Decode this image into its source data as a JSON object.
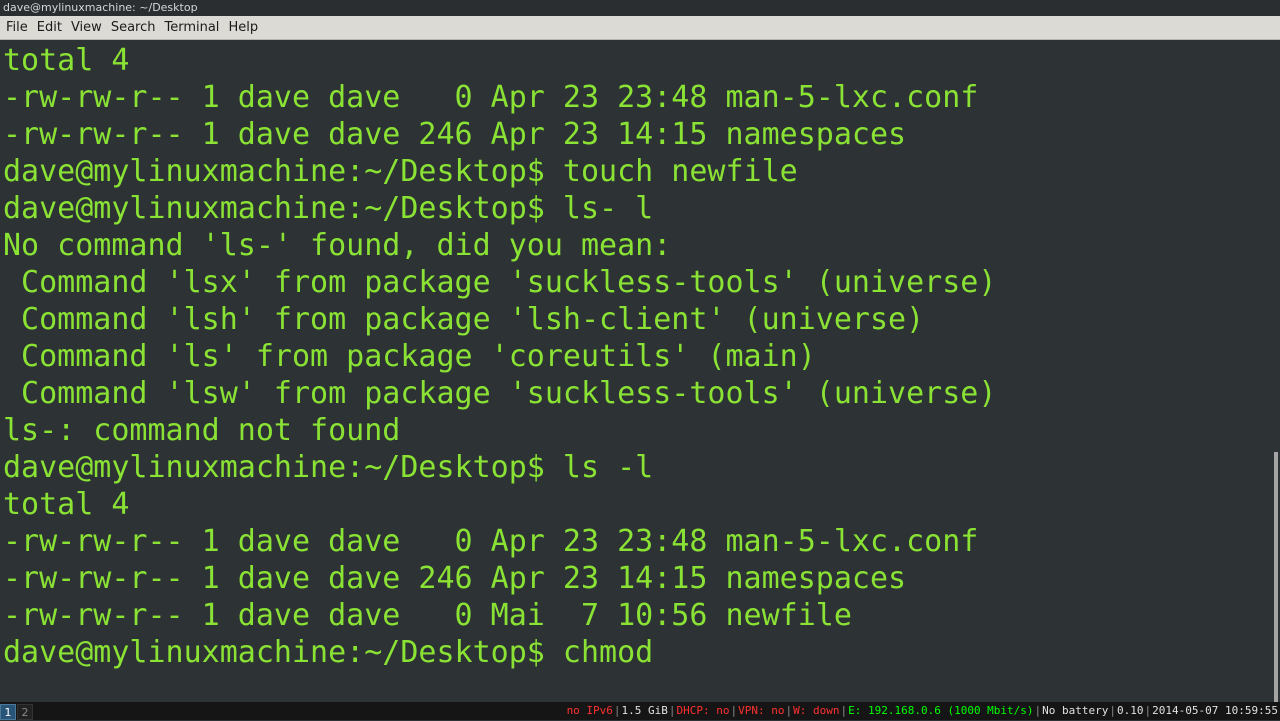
{
  "window": {
    "title": "dave@mylinuxmachine: ~/Desktop"
  },
  "menu": [
    "File",
    "Edit",
    "View",
    "Search",
    "Terminal",
    "Help"
  ],
  "terminal": {
    "text_color": "#8ae234",
    "background": "#2d3235",
    "lines": [
      "total 4",
      "-rw-rw-r-- 1 dave dave   0 Apr 23 23:48 man-5-lxc.conf",
      "-rw-rw-r-- 1 dave dave 246 Apr 23 14:15 namespaces",
      "dave@mylinuxmachine:~/Desktop$ touch newfile",
      "dave@mylinuxmachine:~/Desktop$ ls- l",
      "No command 'ls-' found, did you mean:",
      " Command 'lsx' from package 'suckless-tools' (universe)",
      " Command 'lsh' from package 'lsh-client' (universe)",
      " Command 'ls' from package 'coreutils' (main)",
      " Command 'lsw' from package 'suckless-tools' (universe)",
      "ls-: command not found",
      "dave@mylinuxmachine:~/Desktop$ ls -l",
      "total 4",
      "-rw-rw-r-- 1 dave dave   0 Apr 23 23:48 man-5-lxc.conf",
      "-rw-rw-r-- 1 dave dave 246 Apr 23 14:15 namespaces",
      "-rw-rw-r-- 1 dave dave   0 Mai  7 10:56 newfile",
      "dave@mylinuxmachine:~/Desktop$ chmod "
    ]
  },
  "statusbar": {
    "workspaces": [
      "1",
      "2"
    ],
    "active_workspace": "1",
    "ipv6": "no IPv6",
    "disk": "1.5 GiB",
    "dhcp": "DHCP: no",
    "vpn": "VPN: no",
    "wireless": "W: down",
    "ethernet": "E: 192.168.0.6 (1000 Mbit/s)",
    "battery": "No battery",
    "load": "0.10",
    "datetime": "2014-05-07 10:59:55",
    "colors": {
      "bad": "#ff3030",
      "good": "#00ff00",
      "neutral": "#e0e0e0"
    }
  }
}
